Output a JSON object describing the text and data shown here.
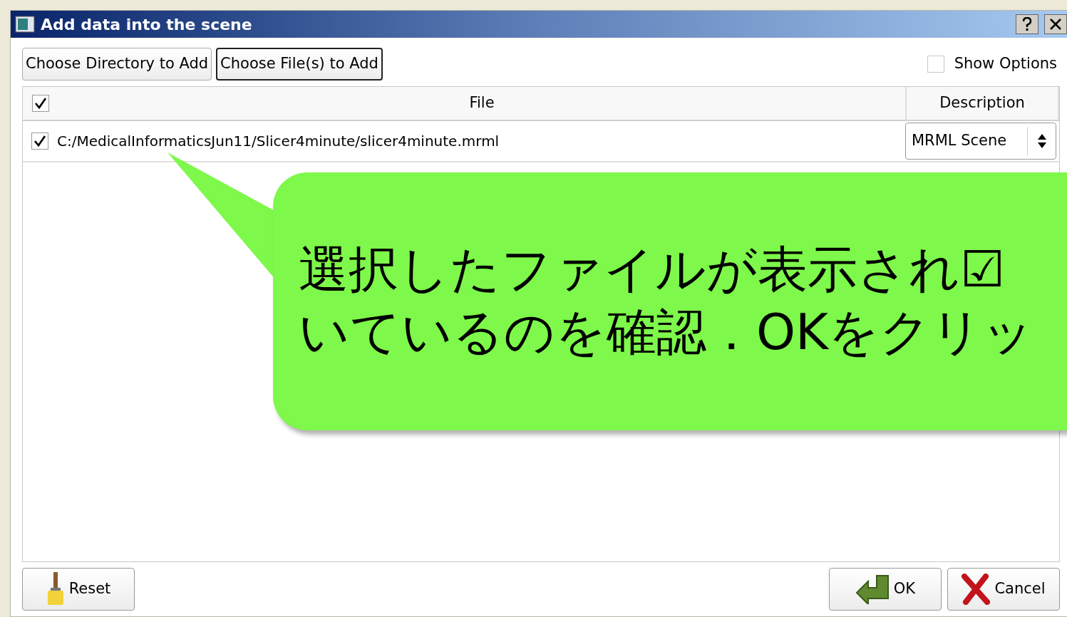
{
  "window": {
    "title": "Add data into the scene"
  },
  "toolbar": {
    "buttons": [
      {
        "label": "Choose Directory to Add",
        "selected": false
      },
      {
        "label": "Choose File(s) to Add",
        "selected": true
      }
    ],
    "show_options": {
      "label": "Show Options",
      "checked": false
    }
  },
  "table": {
    "header": {
      "checked": true,
      "columns": [
        "File",
        "Description"
      ]
    },
    "rows": [
      {
        "checked": true,
        "file": "C:/MedicalInformaticsJun11/Slicer4minute/slicer4minute.mrml",
        "description": "MRML Scene"
      }
    ]
  },
  "callout": {
    "lines": [
      "選択したファイルが表示され☑",
      "いているのを確認．OKをクリッ"
    ]
  },
  "footer": {
    "buttons": [
      {
        "kind": "reset",
        "label": "Reset"
      },
      {
        "kind": "ok",
        "label": "OK"
      },
      {
        "kind": "cancel",
        "label": "Cancel"
      }
    ]
  }
}
